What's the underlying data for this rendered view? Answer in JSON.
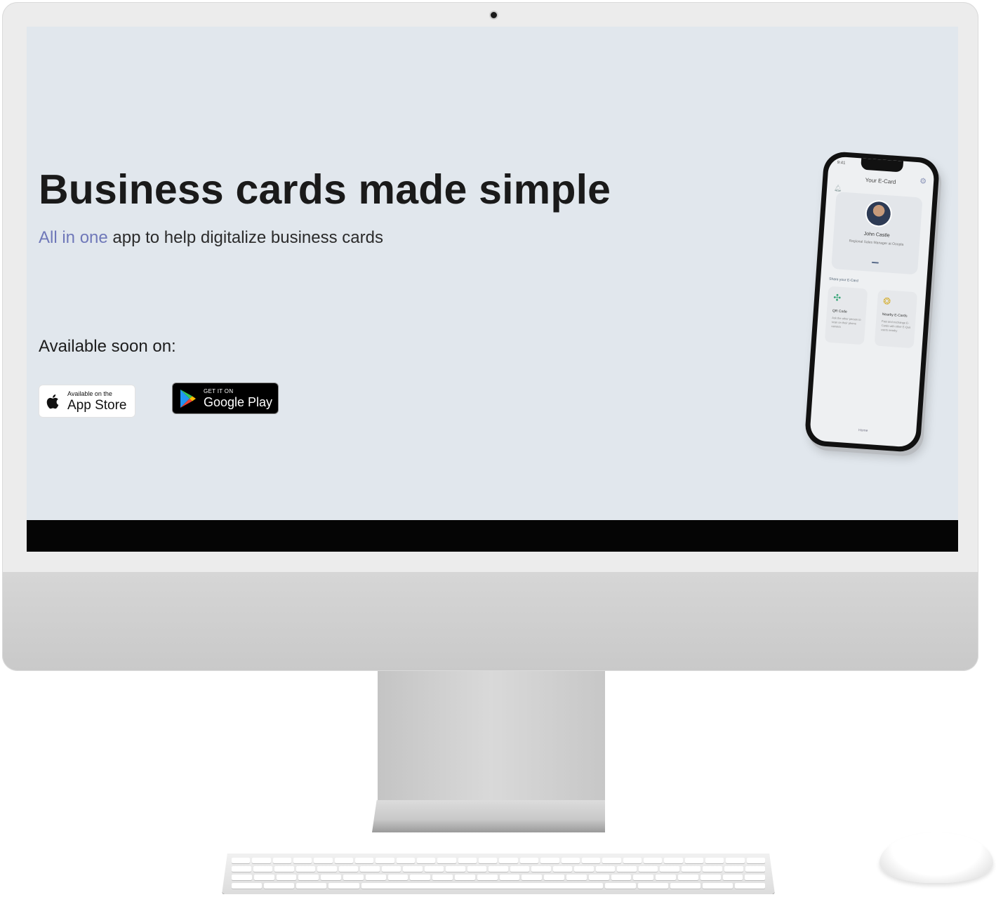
{
  "hero": {
    "title": "Business cards made simple",
    "subtitle_accent": "All in one",
    "subtitle_rest": " app to help digitalize business cards"
  },
  "availability": {
    "label": "Available soon on:",
    "app_store": {
      "small": "Available on the",
      "big": "App Store",
      "icon": "apple-icon"
    },
    "google_play": {
      "small": "GET IT ON",
      "big": "Google Play",
      "icon": "google-play-icon"
    }
  },
  "phone_preview": {
    "time": "9:41",
    "header": "Your E-Card",
    "name": "John Castle",
    "role": "Regional Sales Manager at Ooopla",
    "share_label": "Share your E-Card",
    "tiles": [
      {
        "title": "QR Code",
        "desc": "Ask the other person to scan on their phone camera"
      },
      {
        "title": "Nearby E-Cards",
        "desc": "Fast and exchange E-Cards with other E-Quit users nearby"
      }
    ],
    "nav_label": "Home"
  },
  "colors": {
    "screen_bg": "#e1e7ed",
    "accent": "#6f78b9",
    "title": "#1a1a1a"
  }
}
